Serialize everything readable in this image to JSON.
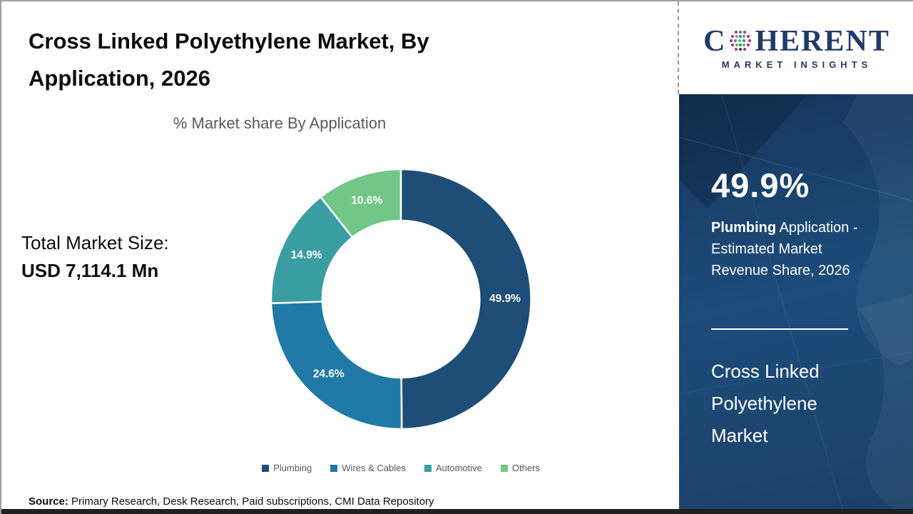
{
  "page": {
    "title_line1": "Cross Linked Polyethylene Market, By",
    "title_line2": "Application, 2026",
    "source_label": "Source:",
    "source_text": " Primary Research, Desk Research, Paid subscriptions, CMI Data Repository"
  },
  "logo": {
    "word_start": "C",
    "word_rest": "HERENT",
    "subtitle": "MARKET INSIGHTS",
    "brand_color": "#203a6a"
  },
  "total_market": {
    "label": "Total Market Size:",
    "value": "USD 7,114.1 Mn"
  },
  "sidebar": {
    "highlight_value": "49.9%",
    "highlight_bold": "Plumbing",
    "highlight_rest": " Application - Estimated Market Revenue Share, 2026",
    "footer_lines": [
      "Cross Linked",
      "Polyethylene",
      "Market"
    ],
    "panel_color": "#1d4d7c"
  },
  "chart_data": {
    "type": "pie",
    "donut": true,
    "title": "% Market share By Application",
    "categories": [
      "Plumbing",
      "Wires & Cables",
      "Automotive",
      "Others"
    ],
    "values": [
      49.9,
      24.6,
      14.9,
      10.6
    ],
    "labels": [
      "49.9%",
      "24.6%",
      "14.9%",
      "10.6%"
    ],
    "colors": [
      "#1E4E78",
      "#2079A7",
      "#3A9DA1",
      "#72C688"
    ],
    "label_color": "#ffffff",
    "start_angle_deg": 0,
    "direction": "clockwise",
    "legend_position": "bottom"
  }
}
